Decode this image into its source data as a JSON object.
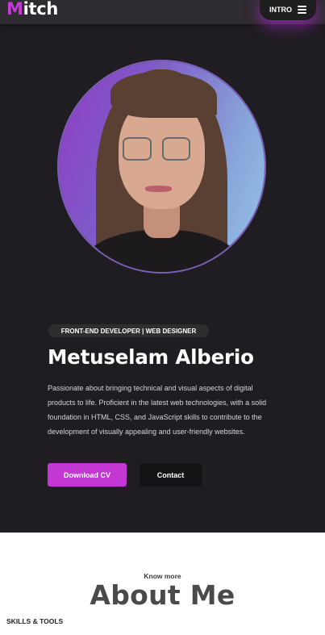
{
  "header": {
    "logo_initial": "M",
    "logo_rest": "itch",
    "nav_label": "INTRO"
  },
  "hero": {
    "role": "FRONT-END DEVELOPER | WEB DESIGNER",
    "name": "Metuselam Alberio",
    "bio": "Passionate about bringing technical and visual aspects of digital products to life. Proficient in the latest web technologies, with a solid foundation in HTML, CSS, and JavaScript skills to contribute to the development of visually appealing and user-friendly websites.",
    "primary_button": "Download CV",
    "secondary_button": "Contact"
  },
  "about": {
    "kicker": "Know more",
    "title": "About Me",
    "skills_label": "SKILLS & TOOLS"
  },
  "colors": {
    "accent": "#c938d8",
    "hero_bg": "#1f1d21",
    "header_bg": "#2e2c30",
    "primary_button": "#c338d2",
    "secondary_button": "#131214"
  }
}
